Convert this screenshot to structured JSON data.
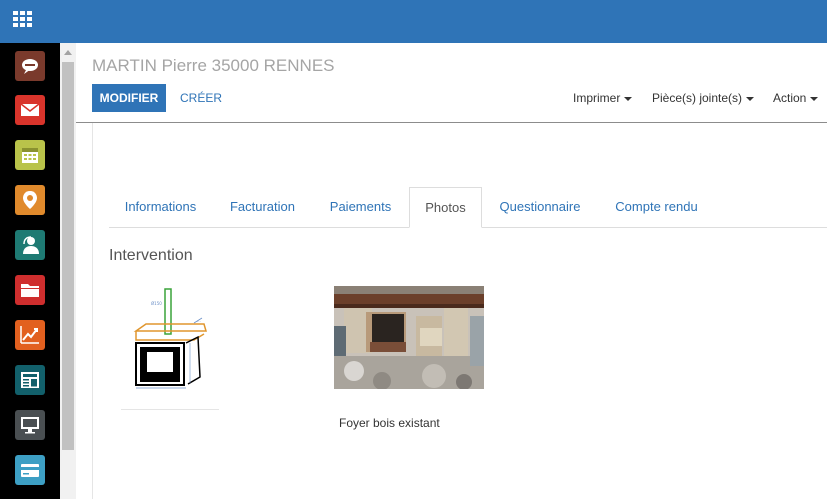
{
  "header": {
    "title": "MARTIN Pierre 35000 RENNES",
    "buttons": {
      "edit": "MODIFIER",
      "create": "CRÉER"
    },
    "menus": [
      "Imprimer",
      "Pièce(s) jointe(s)",
      "Action"
    ]
  },
  "tabs": [
    {
      "label": "Informations"
    },
    {
      "label": "Facturation"
    },
    {
      "label": "Paiements"
    },
    {
      "label": "Photos",
      "active": true
    },
    {
      "label": "Questionnaire"
    },
    {
      "label": "Compte rendu"
    }
  ],
  "section": {
    "title": "Intervention"
  },
  "photos": [
    {
      "caption": ""
    },
    {
      "caption": "Foyer bois existant"
    }
  ],
  "sidebar": {
    "items": [
      {
        "icon": "chat-icon",
        "color": "#7a3a2c"
      },
      {
        "icon": "mail-icon",
        "color": "#d9342b"
      },
      {
        "icon": "calendar-icon",
        "color": "#b9c34a"
      },
      {
        "icon": "location-icon",
        "color": "#e08a2c"
      },
      {
        "icon": "support-icon",
        "color": "#1e7a73"
      },
      {
        "icon": "folder-icon",
        "color": "#cf2e2e"
      },
      {
        "icon": "chart-icon",
        "color": "#e2601f"
      },
      {
        "icon": "newspaper-icon",
        "color": "#12606b"
      },
      {
        "icon": "monitor-icon",
        "color": "#4a4f52"
      },
      {
        "icon": "card-icon",
        "color": "#3d9fc4"
      }
    ]
  },
  "colors": {
    "brand": "#2f74b7",
    "sidebar": "#000000"
  }
}
